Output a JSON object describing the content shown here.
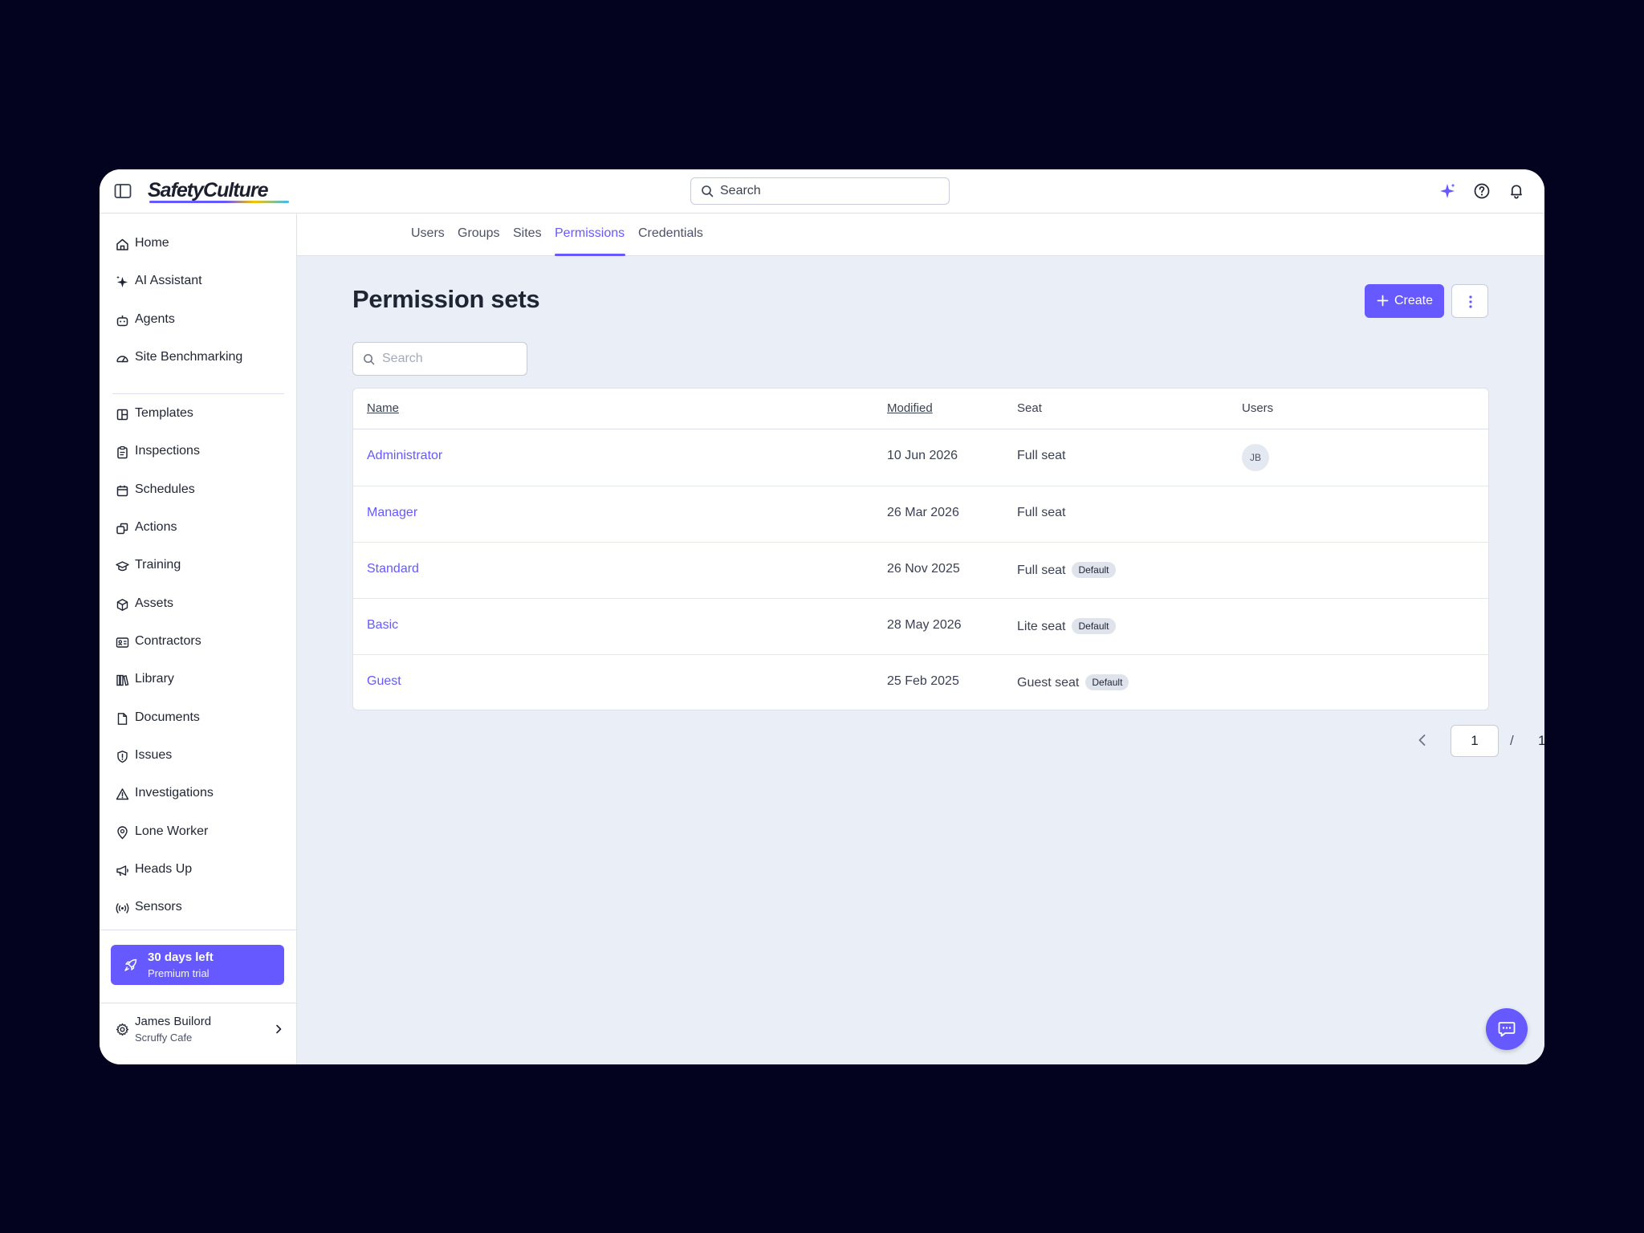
{
  "app": {
    "logo_text": "SafetyCulture",
    "accent_color": "#6559ff"
  },
  "topbar": {
    "search_placeholder": "Search",
    "icons": [
      "sidebar-toggle-icon",
      "ai-sparkle-icon",
      "help-icon",
      "bell-icon"
    ]
  },
  "sidebar": {
    "items": [
      {
        "label": "Home",
        "icon": "home-icon"
      },
      {
        "label": "AI Assistant",
        "icon": "sparkle-icon"
      },
      {
        "label": "Agents",
        "icon": "robot-icon"
      },
      {
        "label": "Site Benchmarking",
        "icon": "gauge-icon"
      },
      {
        "label": "Templates",
        "icon": "template-icon"
      },
      {
        "label": "Inspections",
        "icon": "clipboard-icon"
      },
      {
        "label": "Schedules",
        "icon": "calendar-icon"
      },
      {
        "label": "Actions",
        "icon": "actions-icon"
      },
      {
        "label": "Training",
        "icon": "graduation-cap-icon"
      },
      {
        "label": "Assets",
        "icon": "cube-icon"
      },
      {
        "label": "Contractors",
        "icon": "id-card-icon"
      },
      {
        "label": "Library",
        "icon": "books-icon"
      },
      {
        "label": "Documents",
        "icon": "document-icon"
      },
      {
        "label": "Issues",
        "icon": "issue-shield-icon"
      },
      {
        "label": "Investigations",
        "icon": "warning-triangle-icon"
      },
      {
        "label": "Lone Worker",
        "icon": "map-pin-icon"
      },
      {
        "label": "Heads Up",
        "icon": "megaphone-icon"
      },
      {
        "label": "Sensors",
        "icon": "signal-icon"
      }
    ],
    "trial": {
      "title": "30 days left",
      "subtitle": "Premium trial",
      "icon": "rocket-icon"
    },
    "user": {
      "name": "James Builord",
      "org": "Scruffy Cafe",
      "icon": "gear-icon"
    }
  },
  "tabs": [
    "Users",
    "Groups",
    "Sites",
    "Permissions",
    "Credentials"
  ],
  "active_tab": "Permissions",
  "main": {
    "title": "Permission sets",
    "create_label": "Create",
    "search_placeholder": "Search",
    "table": {
      "headers": {
        "name": "Name",
        "modified": "Modified",
        "seat": "Seat",
        "users": "Users"
      },
      "rows": [
        {
          "name": "Administrator",
          "modified": "10 Jun 2026",
          "seat": "Full seat",
          "badge": "",
          "user_initials": "JB"
        },
        {
          "name": "Manager",
          "modified": "26 Mar 2026",
          "seat": "Full seat",
          "badge": "",
          "user_initials": ""
        },
        {
          "name": "Standard",
          "modified": "26 Nov 2025",
          "seat": "Full seat",
          "badge": "Default",
          "user_initials": ""
        },
        {
          "name": "Basic",
          "modified": "28 May 2026",
          "seat": "Lite seat",
          "badge": "Default",
          "user_initials": ""
        },
        {
          "name": "Guest",
          "modified": "25 Feb 2025",
          "seat": "Guest seat",
          "badge": "Default",
          "user_initials": ""
        }
      ]
    },
    "pagination": {
      "current": "1",
      "separator": "/",
      "total": "1"
    }
  }
}
